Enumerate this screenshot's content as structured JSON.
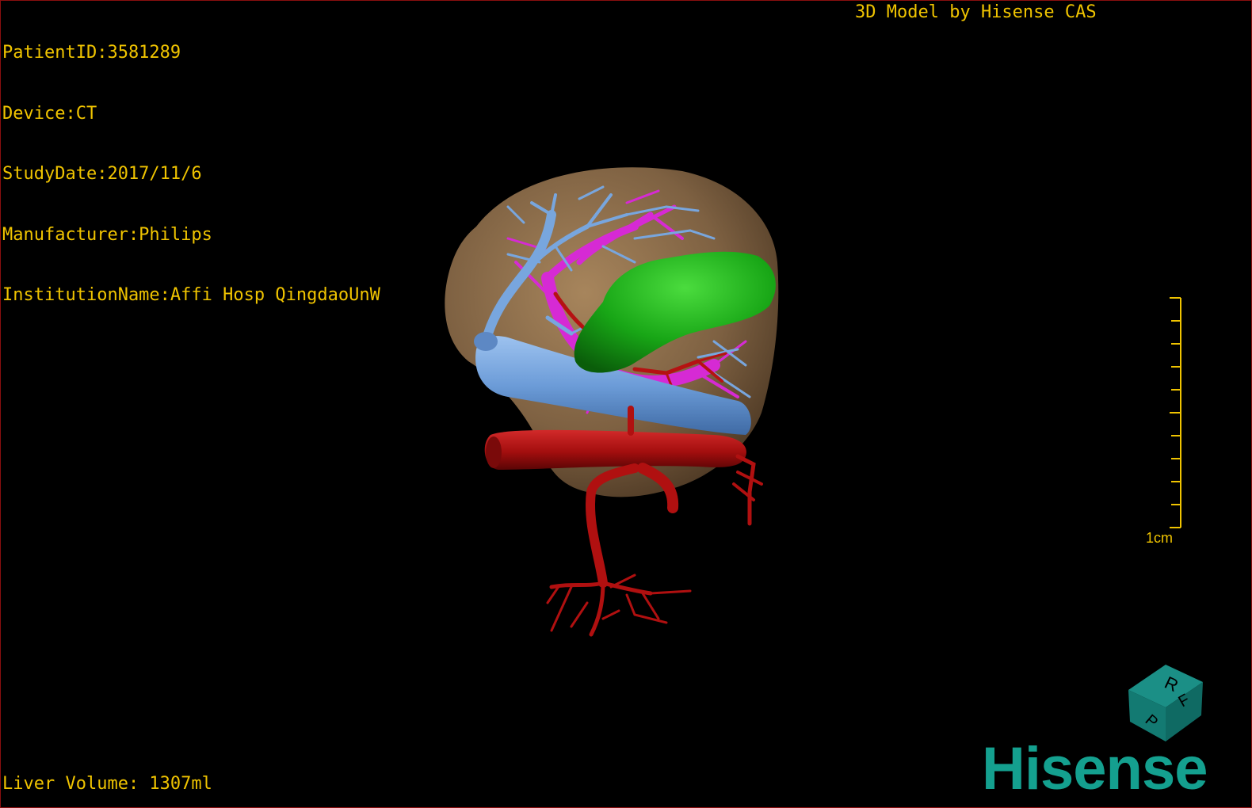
{
  "study": {
    "patient_id": "PatientID:3581289",
    "device": "Device:CT",
    "study_date": "StudyDate:2017/11/6",
    "manufacturer": "Manufacturer:Philips",
    "institution": "InstitutionName:Affi Hosp QingdaoUnW"
  },
  "header": {
    "model_credit": "3D Model by Hisense CAS"
  },
  "footer": {
    "liver_volume": "Liver Volume: 1307ml"
  },
  "scale_bar": {
    "label": "1cm"
  },
  "orientation_cube": {
    "face_labels": [
      "R",
      "F",
      "P"
    ]
  },
  "brand": {
    "logo_text": "Hisense"
  },
  "colors": {
    "overlay_text": "#f0c400",
    "background": "#000000",
    "border": "#8a0f0f",
    "liver": "#8a6b47",
    "hepatic_vein": "#6e9fd8",
    "portal_vein": "#d62ad4",
    "artery": "#b01010",
    "tumor": "#13a313",
    "brand": "#14a08f"
  },
  "model_parts": [
    "liver",
    "hepatic-vein",
    "portal-vein",
    "hepatic-artery",
    "tumor",
    "aorta"
  ]
}
